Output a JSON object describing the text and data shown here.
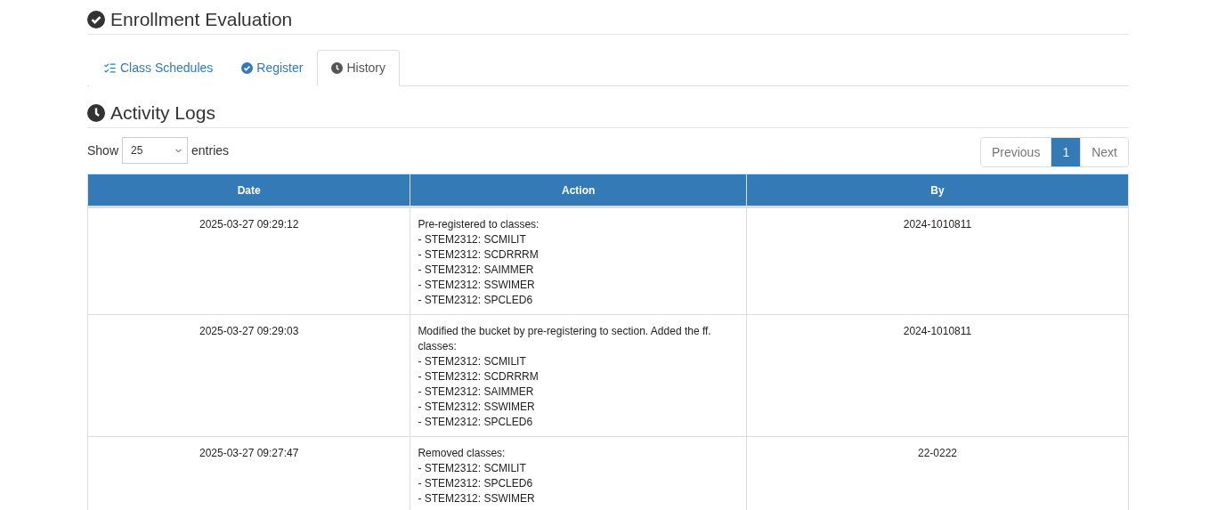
{
  "page_title": "Enrollment Evaluation",
  "tabs": [
    {
      "label": "Class Schedules",
      "kind": "list",
      "selected": false
    },
    {
      "label": "Register",
      "kind": "check",
      "selected": false
    },
    {
      "label": "History",
      "kind": "clock",
      "selected": true
    }
  ],
  "section_title": "Activity Logs",
  "length_control": {
    "prefix": "Show",
    "value": "25",
    "suffix": "entries"
  },
  "pagination": [
    {
      "label": "Previous",
      "selected": false,
      "disabled": true
    },
    {
      "label": "1",
      "selected": true,
      "disabled": false
    },
    {
      "label": "Next",
      "selected": false,
      "disabled": true
    }
  ],
  "table": {
    "columns": [
      "Date",
      "Action",
      "By"
    ],
    "rows": [
      {
        "date": "2025-03-27 09:29:12",
        "action": [
          "Pre-registered to classes:",
          "- STEM2312: SCMILIT",
          "- STEM2312: SCDRRRM",
          "- STEM2312: SAIMMER",
          "- STEM2312: SSWIMER",
          "- STEM2312: SPCLED6"
        ],
        "by": "2024-1010811"
      },
      {
        "date": "2025-03-27 09:29:03",
        "action": [
          "Modified the bucket by pre-registering to section. Added the ff. classes:",
          "- STEM2312: SCMILIT",
          "- STEM2312: SCDRRRM",
          "- STEM2312: SAIMMER",
          "- STEM2312: SSWIMER",
          "- STEM2312: SPCLED6"
        ],
        "by": "2024-1010811"
      },
      {
        "date": "2025-03-27 09:27:47",
        "action": [
          "Removed classes:",
          "- STEM2312: SCMILIT",
          "- STEM2312: SPCLED6",
          "- STEM2312: SSWIMER"
        ],
        "by": "22-0222"
      }
    ]
  }
}
